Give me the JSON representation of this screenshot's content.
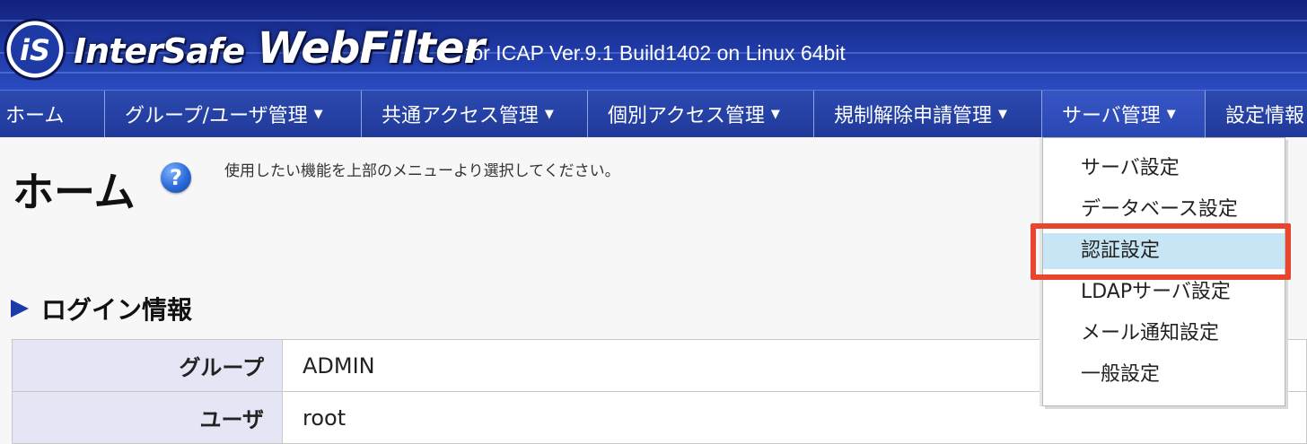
{
  "header": {
    "logo_text_prefix": "InterSafe",
    "logo_text_suffix": "WebFilter",
    "logo_mark": "iS",
    "version_text": "for ICAP Ver.9.1 Build1402 on Linux 64bit"
  },
  "nav": {
    "items": [
      {
        "label": "ホーム",
        "has_arrow": false
      },
      {
        "label": "グループ/ユーザ管理",
        "has_arrow": true
      },
      {
        "label": "共通アクセス管理",
        "has_arrow": true
      },
      {
        "label": "個別アクセス管理",
        "has_arrow": true
      },
      {
        "label": "規制解除申請管理",
        "has_arrow": true
      },
      {
        "label": "サーバ管理",
        "has_arrow": true
      },
      {
        "label": "設定情報",
        "has_arrow": false
      }
    ],
    "arrow_glyph": "▼",
    "active_item": "サーバ管理"
  },
  "page": {
    "title": "ホーム",
    "help_glyph": "?",
    "hint": "使用したい機能を上部のメニューより選択してください。"
  },
  "login_section": {
    "heading": "ログイン情報",
    "rows": [
      {
        "label": "グループ",
        "value": "ADMIN"
      },
      {
        "label": "ユーザ",
        "value": "root"
      }
    ]
  },
  "server_menu": {
    "items": [
      "サーバ設定",
      "データベース設定",
      "認証設定",
      "LDAPサーバ設定",
      "メール通知設定",
      "一般設定"
    ],
    "highlighted_item": "認証設定"
  },
  "colors": {
    "banner": "#1f3aa6",
    "nav": "#2a48b4",
    "menu_highlight": "#c7e6f5",
    "callout_border": "#e8452e",
    "label_cell": "#e4e6f5"
  }
}
